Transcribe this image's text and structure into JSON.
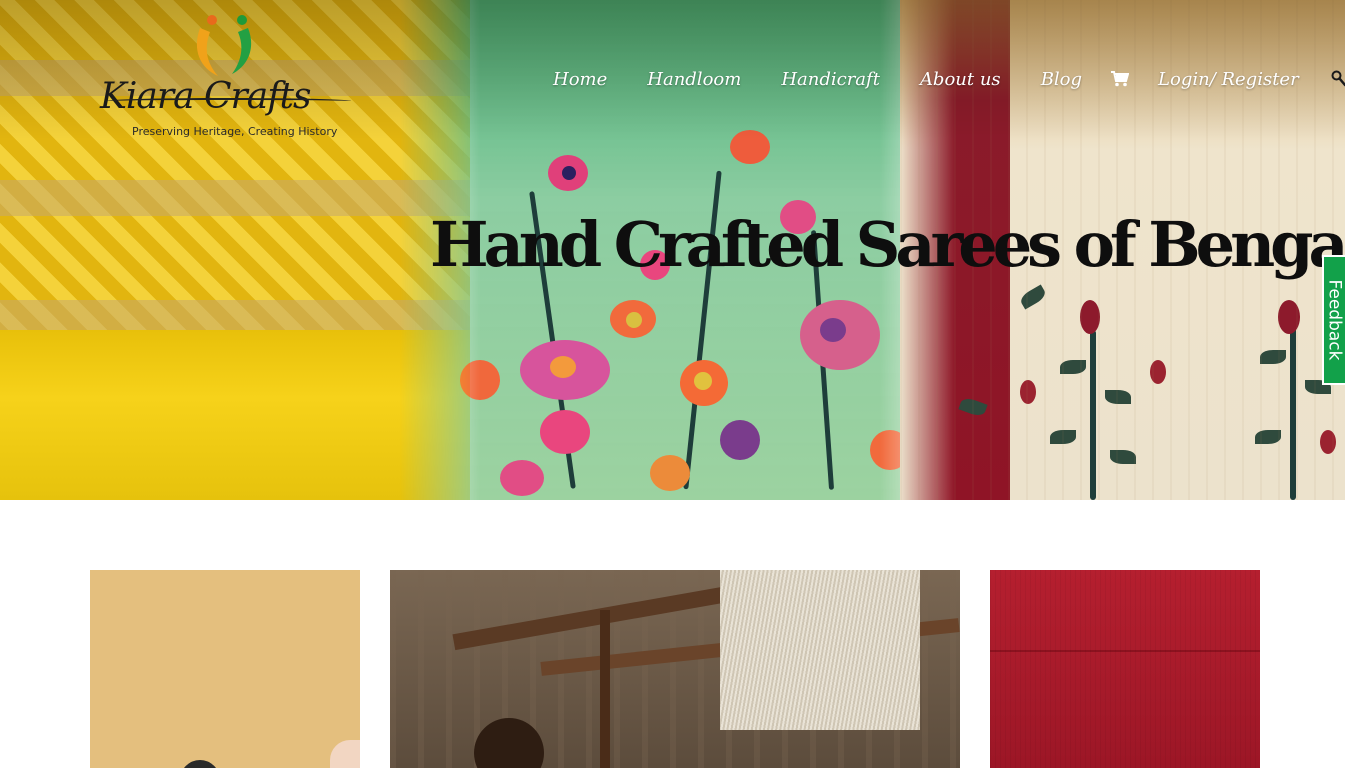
{
  "brand": {
    "name": "Kiara Crafts",
    "tagline": "Preserving Heritage, Creating History"
  },
  "nav": {
    "items": [
      {
        "label": "Home"
      },
      {
        "label": "Handloom"
      },
      {
        "label": "Handicraft"
      },
      {
        "label": "About us"
      },
      {
        "label": "Blog"
      }
    ],
    "cart_icon": "shopping-cart-icon",
    "account_label": "Login/ Register",
    "search_icon": "search-icon"
  },
  "hero": {
    "title": "Hand Crafted Sarees of Bengal"
  },
  "feedback": {
    "label": "Feedback",
    "color": "#12a14a"
  },
  "colors": {
    "nav_text": "#ffffff",
    "title_text": "#0e0e0e"
  }
}
